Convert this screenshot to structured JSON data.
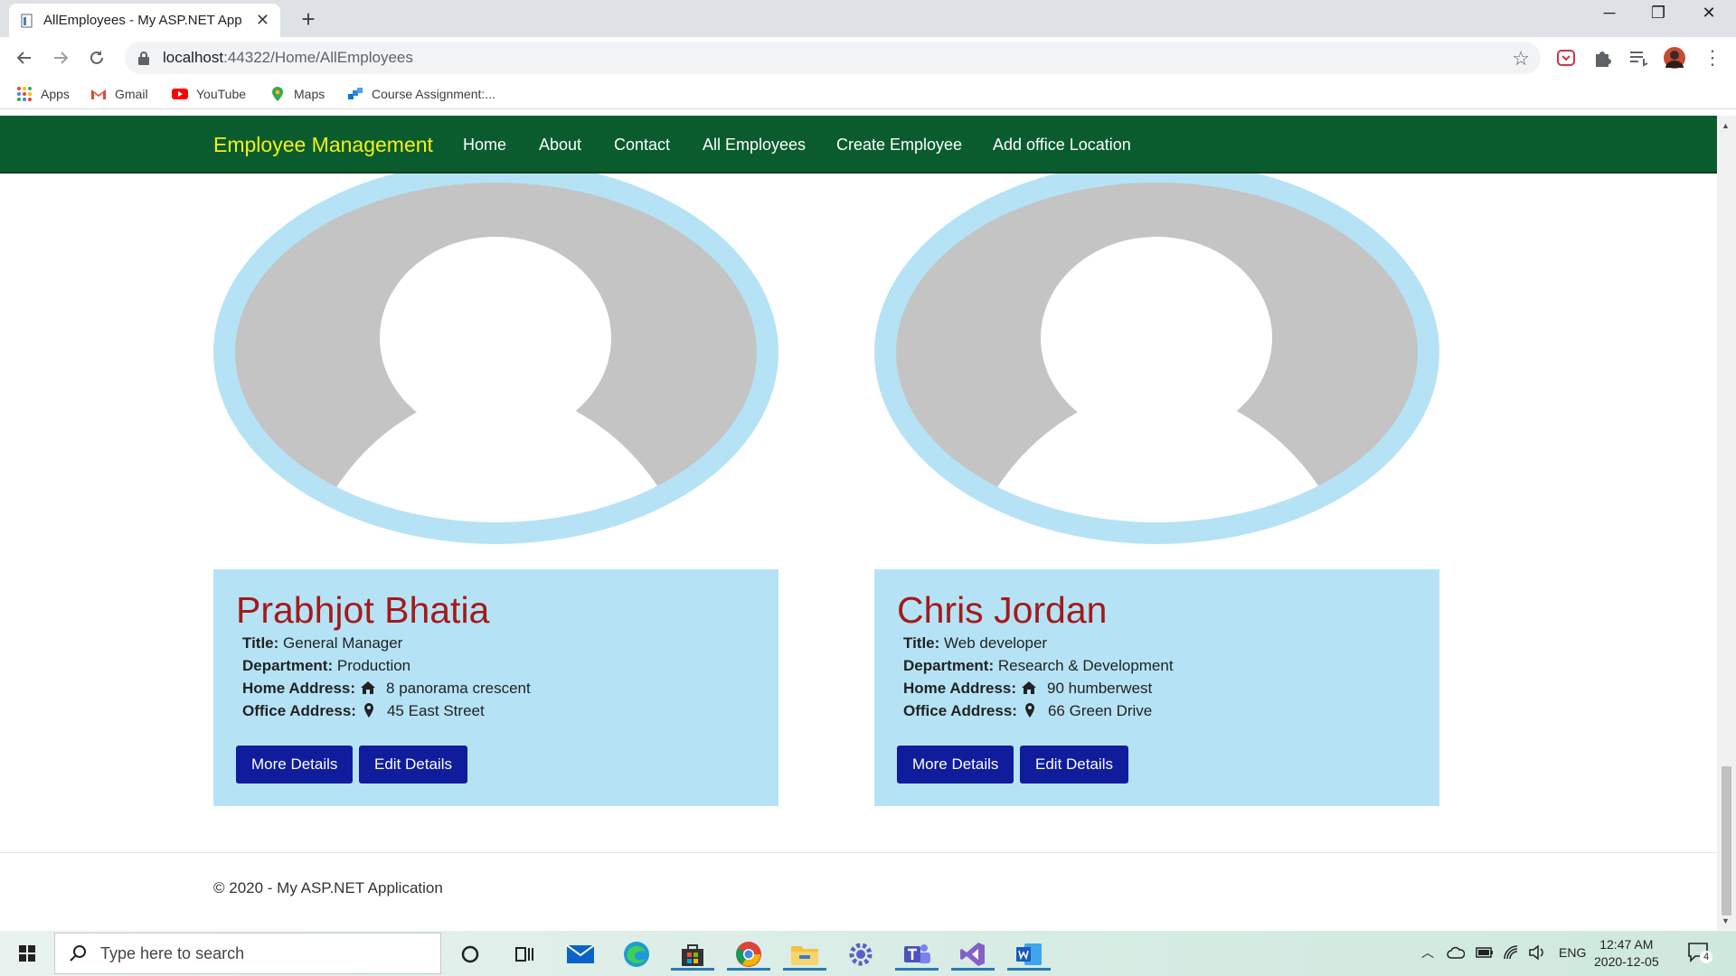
{
  "browser": {
    "tab_title": "AllEmployees - My ASP.NET Appl",
    "url_host": "localhost",
    "url_path": ":44322/Home/AllEmployees",
    "window_controls": {
      "minimize": "─",
      "restore": "❐",
      "close": "✕"
    },
    "bookmarks": [
      "Apps",
      "Gmail",
      "YouTube",
      "Maps",
      "Course Assignment:..."
    ]
  },
  "navbar": {
    "brand": "Employee Management",
    "links": [
      "Home",
      "About",
      "Contact",
      "All Employees",
      "Create Employee",
      "Add office Location"
    ]
  },
  "employees": [
    {
      "name": "Prabhjot Bhatia",
      "title_label": "Title:",
      "title": "General Manager",
      "department_label": "Department:",
      "department": "Production",
      "home_label": "Home Address:",
      "home": "8 panorama crescent",
      "office_label": "Office Address:",
      "office": "45 East Street",
      "more_button": "More Details",
      "edit_button": "Edit Details"
    },
    {
      "name": "Chris Jordan",
      "title_label": "Title:",
      "title": "Web developer",
      "department_label": "Department:",
      "department": "Research & Development",
      "home_label": "Home Address:",
      "home": "90 humberwest",
      "office_label": "Office Address:",
      "office": "66 Green Drive",
      "more_button": "More Details",
      "edit_button": "Edit Details"
    }
  ],
  "footer": {
    "text": "© 2020 - My ASP.NET Application"
  },
  "taskbar": {
    "search_placeholder": "Type here to search",
    "language": "ENG",
    "time": "12:47 AM",
    "date": "2020-12-05",
    "notification_count": "4"
  },
  "colors": {
    "navbar": "#0a5c2e",
    "brand": "#f3f01a",
    "card": "#b5e3f5",
    "name": "#a31a1a",
    "button": "#0f1c9c"
  }
}
